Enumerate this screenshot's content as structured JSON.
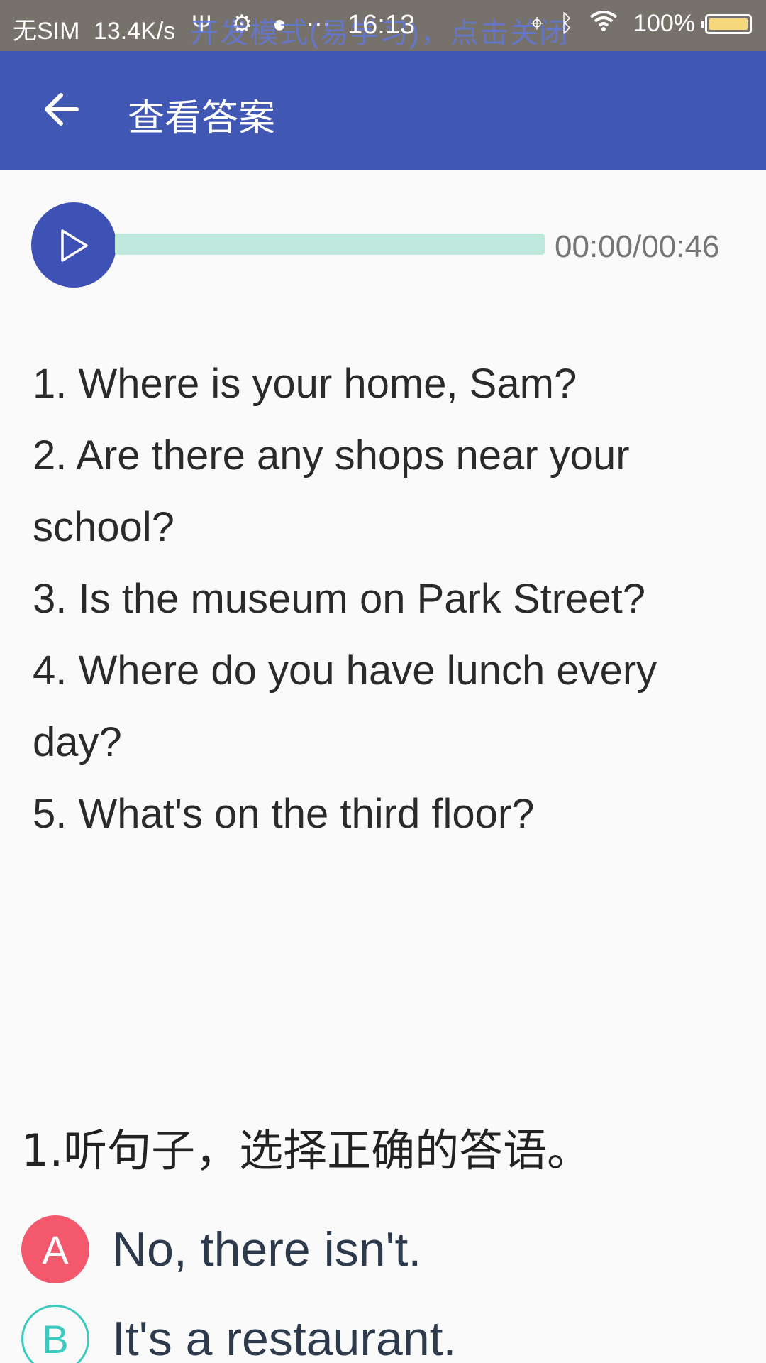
{
  "status_bar": {
    "carrier": "无SIM",
    "net_speed": "13.4K/s",
    "notification_overlay": "开发模式(易学习)，点击关闭",
    "time": "16:13",
    "battery": "100%",
    "icons": [
      "usb-icon",
      "debug-icon",
      "app-icon",
      "more-icon",
      "location-icon",
      "bluetooth-icon",
      "wifi-icon",
      "battery-icon"
    ]
  },
  "app_bar": {
    "title": "查看答案"
  },
  "player": {
    "time": "00:00/00:46",
    "progress": 0
  },
  "transcript": {
    "lines": [
      "1. Where is your home, Sam?",
      "2. Are there any shops near your school?",
      "3. Is the museum on Park Street?",
      "4. Where do you have lunch every day?",
      "5. What's on the third floor?"
    ]
  },
  "question": {
    "text": "1.听句子，选择正确的答语。",
    "options": [
      {
        "letter": "A",
        "text": "No, there isn't.",
        "selected": true
      },
      {
        "letter": "B",
        "text": "It's a restaurant.",
        "selected": false
      }
    ]
  },
  "colors": {
    "app_bar": "#4157b4",
    "play_button": "#3e51b5",
    "progress_track": "#bfe9dd",
    "selected_option": "#f4586d",
    "option_outline": "#3cc9bf"
  }
}
